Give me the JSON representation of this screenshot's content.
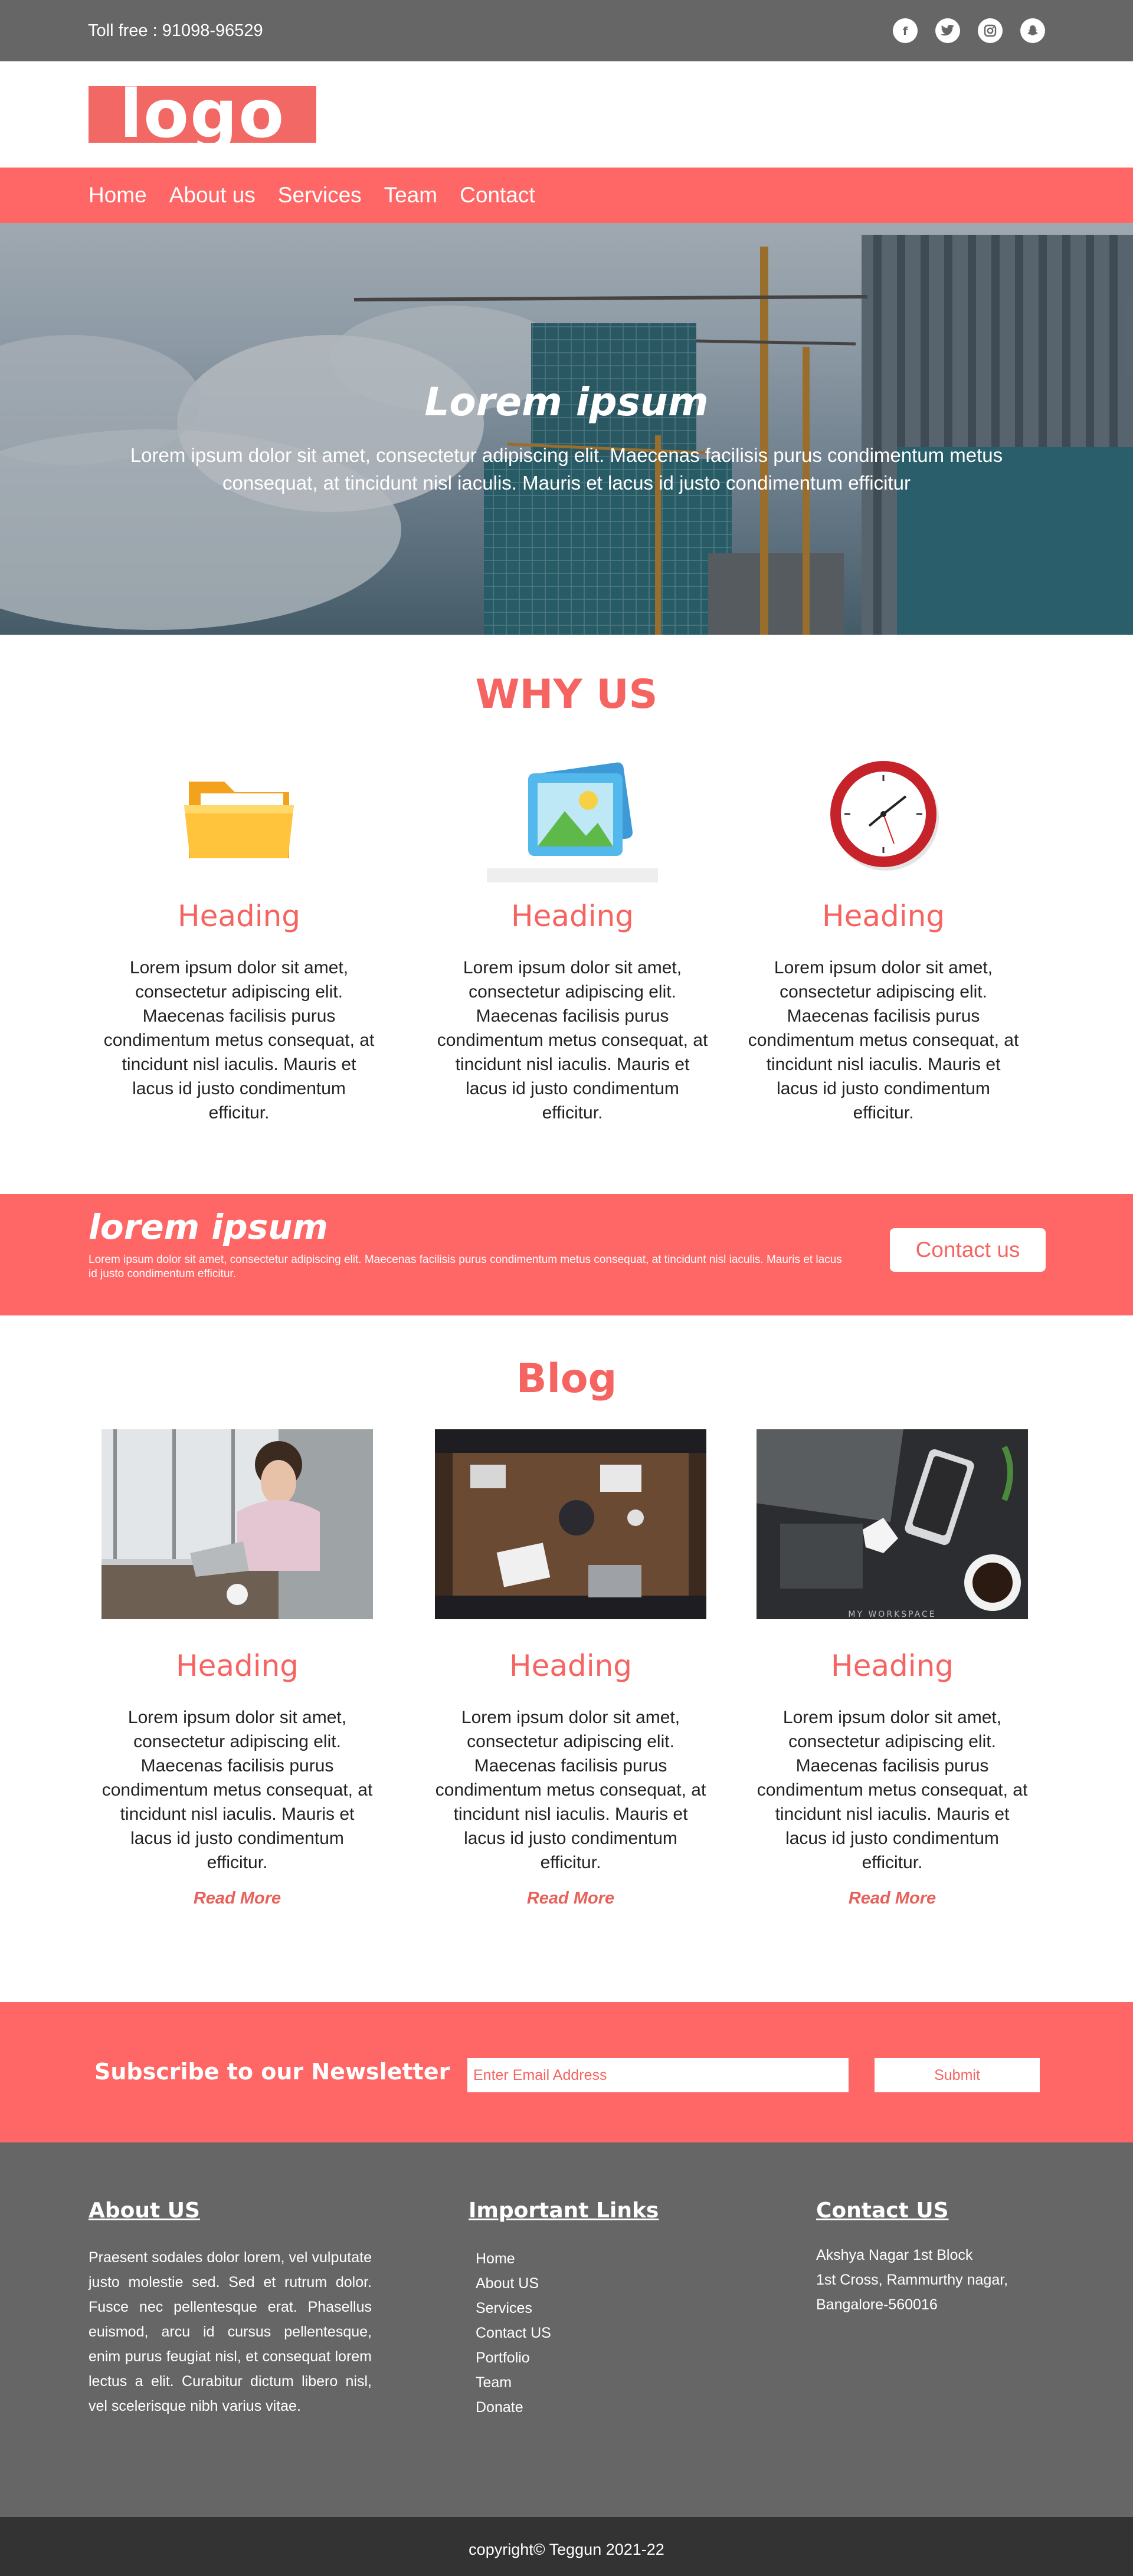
{
  "topbar": {
    "toll": "Toll free : 91098-96529",
    "social": [
      {
        "icon": "facebook-icon",
        "glyph": "f"
      },
      {
        "icon": "twitter-icon",
        "glyph": "t"
      },
      {
        "icon": "instagram-icon",
        "glyph": "◎"
      },
      {
        "icon": "snapchat-icon",
        "glyph": "☺"
      }
    ]
  },
  "logo": {
    "text": "logo"
  },
  "nav": {
    "items": [
      "Home",
      "About us",
      "Services",
      "Team",
      "Contact"
    ]
  },
  "hero": {
    "title": "Lorem ipsum",
    "subtitle": "Lorem ipsum dolor sit amet, consectetur adipiscing elit. Maecenas facilisis purus condimentum metus consequat, at tincidunt nisl iaculis. Mauris et lacus id justo condimentum efficitur"
  },
  "why": {
    "title": "WHY US",
    "cards": [
      {
        "icon": "folder-icon",
        "heading": "Heading",
        "text": "Lorem ipsum dolor sit amet, consectetur adipiscing elit. Maecenas facilisis purus condimentum metus consequat, at tincidunt nisl iaculis. Mauris et lacus id justo condimentum efficitur."
      },
      {
        "icon": "image-icon",
        "heading": "Heading",
        "text": "Lorem ipsum dolor sit amet, consectetur adipiscing elit. Maecenas facilisis purus condimentum metus consequat, at tincidunt nisl iaculis. Mauris et lacus id justo condimentum efficitur."
      },
      {
        "icon": "clock-icon",
        "heading": "Heading",
        "text": "Lorem ipsum dolor sit amet, consectetur adipiscing elit. Maecenas facilisis purus condimentum metus consequat, at tincidunt nisl iaculis. Mauris et lacus id justo condimentum efficitur."
      }
    ]
  },
  "cta": {
    "title": "lorem ipsum",
    "text": "Lorem ipsum dolor sit amet, consectetur adipiscing elit. Maecenas facilisis purus condimentum metus consequat, at tincidunt nisl iaculis. Mauris et lacus id justo condimentum efficitur.",
    "button": "Contact us"
  },
  "blog": {
    "title": "Blog",
    "posts": [
      {
        "heading": "Heading",
        "text": "Lorem ipsum dolor sit amet, consectetur adipiscing elit. Maecenas facilisis purus condimentum metus consequat, at tincidunt nisl iaculis. Mauris et lacus id justo condimentum efficitur.",
        "more": "Read More"
      },
      {
        "heading": "Heading",
        "text": "Lorem ipsum dolor sit amet, consectetur adipiscing elit. Maecenas facilisis purus condimentum metus consequat, at tincidunt nisl iaculis. Mauris et lacus id justo condimentum efficitur.",
        "more": "Read More"
      },
      {
        "heading": "Heading",
        "text": "Lorem ipsum dolor sit amet, consectetur adipiscing elit. Maecenas facilisis purus condimentum metus consequat, at tincidunt nisl iaculis. Mauris et lacus id justo condimentum efficitur.",
        "more": "Read More"
      }
    ],
    "workspace_caption": "MY WORKSPACE"
  },
  "newsletter": {
    "title": "Subscribe to our Newsletter",
    "placeholder": "Enter Email Address",
    "button": "Submit"
  },
  "footer": {
    "about": {
      "title": "About US",
      "text": "Praesent sodales dolor lorem, vel vulputate justo molestie sed. Sed et rutrum dolor. Fusce nec pellentesque erat. Phasellus euismod, arcu id cursus pellentesque, enim purus feugiat nisl, et consequat lorem lectus a elit. Curabitur dictum libero nisl, vel scelerisque nibh varius vitae."
    },
    "links": {
      "title": "Important Links",
      "items": [
        "Home",
        "About US",
        "Services",
        "Contact US",
        "Portfolio",
        "Team",
        "Donate"
      ]
    },
    "contact": {
      "title": "Contact US",
      "lines": [
        "Akshya Nagar 1st Block",
        "1st Cross, Rammurthy nagar,",
        "Bangalore-560016"
      ]
    }
  },
  "copyright": "copyright© Teggun 2021-22",
  "colors": {
    "accent": "#fe6766",
    "heading": "#f56461",
    "gray": "#666666",
    "dark": "#333333"
  }
}
